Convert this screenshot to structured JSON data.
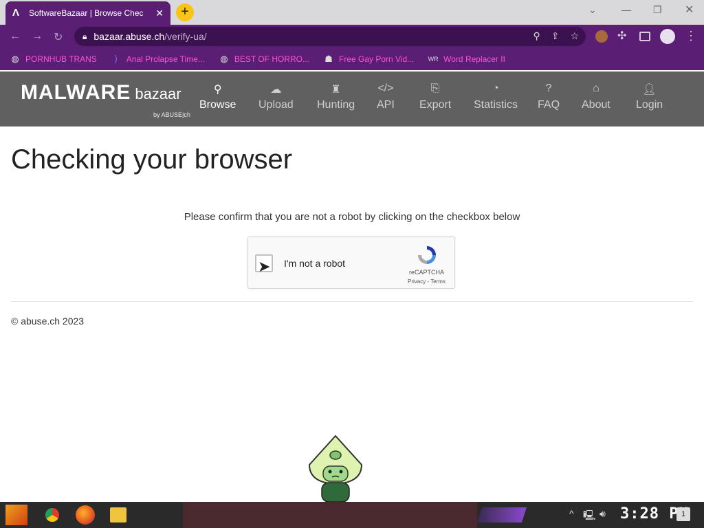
{
  "browser": {
    "tab_title": "SoftwareBazaar | Browse Chec",
    "tab_close": "✕",
    "new_tab": "+",
    "url_host": "bazaar.abuse.ch",
    "url_path": "/verify-ua/",
    "accent": "#5a1f74"
  },
  "bookmarks": [
    {
      "label": "PORNHUB TRANS",
      "icon": "globe-icon"
    },
    {
      "label": "Anal Prolapse Time...",
      "icon": "bracket-icon"
    },
    {
      "label": "BEST OF HORRO...",
      "icon": "globe-icon"
    },
    {
      "label": "Free Gay Porn Vid...",
      "icon": "ghost-icon"
    },
    {
      "label": "Word Replacer II",
      "icon": "wr-icon"
    }
  ],
  "site": {
    "logo_main": "MALWARE",
    "logo_sub": "bazaar",
    "logo_by": "by ABUSE|ch",
    "nav": [
      {
        "label": "Browse",
        "icon": "search-icon",
        "active": true
      },
      {
        "label": "Upload",
        "icon": "cloud-upload-icon"
      },
      {
        "label": "Hunting",
        "icon": "castle-icon"
      },
      {
        "label": "API",
        "icon": "code-icon"
      },
      {
        "label": "Export",
        "icon": "export-icon"
      },
      {
        "label": "Statistics",
        "icon": "pie-chart-icon"
      },
      {
        "label": "FAQ",
        "icon": "question-icon"
      },
      {
        "label": "About",
        "icon": "building-icon"
      },
      {
        "label": "Login",
        "icon": "user-icon"
      }
    ]
  },
  "main": {
    "title": "Checking your browser",
    "instruction": "Please confirm that you are not a robot by clicking on the checkbox below",
    "captcha_label": "I'm not a robot",
    "captcha_brand": "reCAPTCHA",
    "captcha_links": "Privacy - Terms",
    "footer": "© abuse.ch 2023"
  },
  "taskbar": {
    "clock": "3:28 PM",
    "notification_count": "1"
  }
}
